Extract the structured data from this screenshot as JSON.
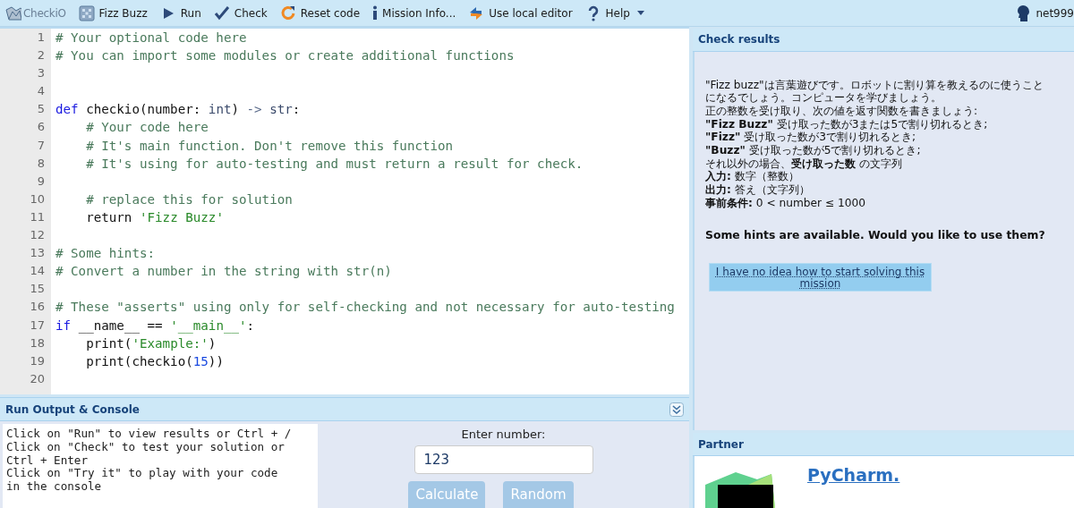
{
  "toolbar": {
    "items": [
      {
        "kind": "logo",
        "label": "CheckiO"
      },
      {
        "kind": "mission",
        "label": "Fizz Buzz"
      },
      {
        "kind": "run",
        "label": "Run"
      },
      {
        "kind": "check",
        "label": "Check"
      },
      {
        "kind": "reset",
        "label": "Reset code"
      },
      {
        "kind": "info",
        "label": "Mission Info..."
      },
      {
        "kind": "local",
        "label": "Use local editor"
      },
      {
        "kind": "help",
        "label": "Help"
      }
    ],
    "user": "net999"
  },
  "editor": {
    "lines": [
      {
        "number": "1",
        "tokens": [
          {
            "kind": "comment",
            "text": "# Your optional code here"
          }
        ]
      },
      {
        "number": "2",
        "tokens": [
          {
            "kind": "comment",
            "text": "# You can import some modules or create additional functions"
          }
        ]
      },
      {
        "number": "3"
      },
      {
        "number": "4"
      },
      {
        "number": "5",
        "tokens": [
          {
            "kind": "keyword",
            "text": "def"
          },
          {
            "kind": "plain",
            "text": " checkio(number: "
          },
          {
            "kind": "builtin",
            "text": "int"
          },
          {
            "kind": "plain",
            "text": ") "
          },
          {
            "kind": "operator",
            "text": "->"
          },
          {
            "kind": "builtin",
            "text": " str"
          },
          {
            "kind": "plain",
            "text": ":"
          }
        ]
      },
      {
        "number": "6",
        "tokens": [
          {
            "kind": "comment",
            "text": "    # Your code here"
          }
        ]
      },
      {
        "number": "7",
        "tokens": [
          {
            "kind": "comment",
            "text": "    # It's main function. Don't remove this function"
          }
        ]
      },
      {
        "number": "8",
        "tokens": [
          {
            "kind": "comment",
            "text": "    # It's using for auto-testing and must return a result for check."
          }
        ]
      },
      {
        "number": "9"
      },
      {
        "number": "10",
        "tokens": [
          {
            "kind": "comment",
            "text": "    # replace this for solution"
          }
        ]
      },
      {
        "number": "11",
        "tokens": [
          {
            "kind": "plain",
            "text": "    return "
          },
          {
            "kind": "string",
            "text": "'Fizz Buzz'"
          }
        ]
      },
      {
        "number": "12"
      },
      {
        "number": "13",
        "tokens": [
          {
            "kind": "comment",
            "text": "# Some hints:"
          }
        ]
      },
      {
        "number": "14",
        "tokens": [
          {
            "kind": "comment",
            "text": "# Convert a number in the string with str(n)"
          }
        ]
      },
      {
        "number": "15"
      },
      {
        "number": "16",
        "tokens": [
          {
            "kind": "comment",
            "text": "# These \"asserts\" using only for self-checking and not necessary for auto-testing"
          }
        ]
      },
      {
        "number": "17",
        "tokens": [
          {
            "kind": "keyword",
            "text": "if"
          },
          {
            "kind": "plain",
            "text": " __name__ == "
          },
          {
            "kind": "string",
            "text": "'__main__'"
          },
          {
            "kind": "plain",
            "text": ":"
          }
        ]
      },
      {
        "number": "18",
        "tokens": [
          {
            "kind": "plain",
            "text": "    print("
          },
          {
            "kind": "string",
            "text": "'Example:'"
          },
          {
            "kind": "plain",
            "text": ")"
          }
        ]
      },
      {
        "number": "19",
        "tokens": [
          {
            "kind": "plain",
            "text": "    print(checkio("
          },
          {
            "kind": "number",
            "text": "15"
          },
          {
            "kind": "plain",
            "text": "))"
          }
        ]
      },
      {
        "number": "20"
      }
    ]
  },
  "console": {
    "title": "Run Output & Console",
    "output": [
      "Click on \"Run\" to view results or Ctrl + /",
      "Click on \"Check\" to test your solution or",
      "Ctrl + Enter",
      "Click on \"Try it\" to play with your code",
      "in the console"
    ],
    "prompt": "Enter number:",
    "value": "123",
    "buttons": [
      "Calculate",
      "Random"
    ]
  },
  "check_results": {
    "title": "Check results",
    "description": [
      "\"Fizz buzz\"は言葉遊びです。ロボットに割り算を教えるのに使うこと",
      "になるでしょう。コンピュータを学びましょう。",
      "正の整数を受け取り、次の値を返す関数を書きましょう:",
      "**\"Fizz Buzz\"** 受け取った数が3または5で割り切れるとき;",
      "**\"Fizz\"** 受け取った数が3で割り切れるとき;",
      "**\"Buzz\"** 受け取った数が5で割り切れるとき;",
      "それ以外の場合、**受け取った数** の文字列",
      "**入力:** 数字（整数）",
      "**出力:** 答え（文字列）",
      "**事前条件:** 0 < number ≤ 1000"
    ],
    "hints_question": "Some hints are available. Would you like to use them?",
    "hint_button": "I have no idea how to start solving this mission"
  },
  "partner": {
    "title": "Partner",
    "link": "PyCharm."
  }
}
